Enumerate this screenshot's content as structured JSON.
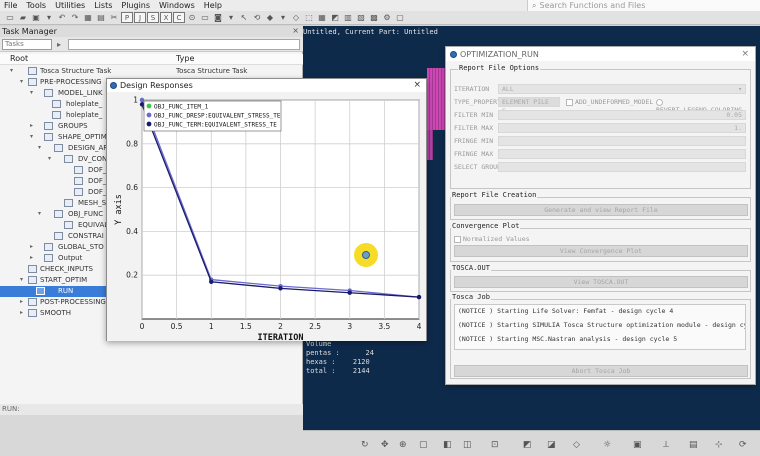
{
  "menu": [
    "File",
    "Tools",
    "Utilities",
    "Lists",
    "Plugins",
    "Windows",
    "Help"
  ],
  "search": {
    "placeholder": "Search Functions and Files"
  },
  "task_manager": {
    "title": "Task Manager",
    "close": "×",
    "filter_value": "Tasks",
    "columns": {
      "root": "Root",
      "type": "Type"
    },
    "rows": [
      {
        "label": "Tosca Structure Task",
        "type": "Tosca Structure Task"
      },
      {
        "label": "PRE-PROCESSING",
        "type": "PRE-PROCESSING"
      },
      {
        "label": "MODEL_LINK",
        "type": "MODEL_LINK"
      },
      {
        "label": "holeplate_",
        "type": ""
      },
      {
        "label": "holeplate_",
        "type": ""
      },
      {
        "label": "GROUPS",
        "type": ""
      },
      {
        "label": "SHAPE_OPTIM",
        "type": ""
      },
      {
        "label": "DESIGN_AR",
        "type": ""
      },
      {
        "label": "DV_CON",
        "type": ""
      },
      {
        "label": "DOF_",
        "type": ""
      },
      {
        "label": "DOF_",
        "type": ""
      },
      {
        "label": "DOF_",
        "type": ""
      },
      {
        "label": "MESH_S",
        "type": ""
      },
      {
        "label": "OBJ_FUNC",
        "type": ""
      },
      {
        "label": "EQUIVAL",
        "type": ""
      },
      {
        "label": "CONSTRAI",
        "type": ""
      },
      {
        "label": "GLOBAL_STO",
        "type": ""
      },
      {
        "label": "Output",
        "type": ""
      },
      {
        "label": "CHECK_INPUTS",
        "type": ""
      },
      {
        "label": "START_OPTIM",
        "type": ""
      },
      {
        "label": "RUN",
        "type": "RUN"
      },
      {
        "label": "POST-PROCESSING",
        "type": "POST-PROCESSING"
      },
      {
        "label": "SMOOTH",
        "type": "SMOOTH"
      }
    ],
    "status": "RUN:"
  },
  "graphics": {
    "title": "Untitled,  Current Part: Untitled",
    "info": [
      {
        "label": "Volume",
        "value": ""
      },
      {
        "label": "pentas :",
        "value": "24"
      },
      {
        "label": "hexas  :",
        "value": "2120"
      },
      {
        "label": "total  :",
        "value": "2144"
      }
    ]
  },
  "chart_window": {
    "title": "Design Responses",
    "close": "×"
  },
  "chart_data": {
    "type": "line",
    "title": "",
    "xlabel": "ITERATION",
    "ylabel": "Y axis",
    "xlim": [
      0,
      4
    ],
    "ylim": [
      0,
      1
    ],
    "xticks": [
      "0",
      "0.5",
      "1",
      "1.5",
      "2",
      "2.5",
      "3",
      "3.5",
      "4"
    ],
    "yticks": [
      "0.2",
      "0.4",
      "0.6",
      "0.8",
      "1"
    ],
    "grid": true,
    "legend_position": "top-left",
    "series": [
      {
        "name": "OBJ_FUNC_ITEM_1",
        "color": "#3cc84a",
        "x": [
          0
        ],
        "y": [
          1.0
        ]
      },
      {
        "name": "OBJ_FUNC_DRESP:EQUIVALENT_STRESS_TE",
        "color": "#6a6ad0",
        "x": [
          0,
          1,
          2,
          3,
          4
        ],
        "y": [
          1.0,
          0.18,
          0.15,
          0.13,
          0.1
        ]
      },
      {
        "name": "OBJ_FUNC_TERM:EQUIVALENT_STRESS_TE",
        "color": "#1a1a6a",
        "x": [
          0,
          1,
          2,
          3,
          4
        ],
        "y": [
          0.98,
          0.17,
          0.14,
          0.12,
          0.1
        ]
      }
    ]
  },
  "optimization": {
    "title": "OPTIMIZATION_RUN",
    "close": "×",
    "report_file_options": "Report File Options",
    "iteration_label": "ITERATION",
    "iteration_value": "ALL",
    "type_property_label": "TYPE_PROPERTY",
    "type_property_value": "ELEMENT PILE S",
    "add_undeformed": "ADD_UNDEFORMED_MODEL",
    "revert_legend": "REVERT_LEGEND_COLORING",
    "filter_min_label": "FILTER MIN",
    "filter_min_value": "0.05",
    "filter_max_label": "FILTER MAX",
    "filter_max_value": "1.",
    "fringe_min_label": "FRINGE MIN",
    "fringe_max_label": "FRINGE MAX",
    "select_group_label": "SELECT GROUP",
    "report_file_creation": "Report File Creation",
    "generate_btn": "Generate and view Report File",
    "convergence_plot": "Convergence Plot",
    "normalized_values": "Normalized Values",
    "view_convergence_btn": "View Convergence Plot",
    "tosca_out": "TOSCA.OUT",
    "view_tosca_btn": "View TOSCA.OUT",
    "tosca_job": "Tosca Job",
    "log": [
      "(NOTICE  ) Starting Life Solver: Femfat - design cycle 4",
      "(NOTICE  ) Starting SIMULIA Tosca Structure optimization module - design cycle",
      "(NOTICE  ) Starting MSC.Nastran analysis - design cycle 5"
    ],
    "abort_btn": "Abort Tosca Job"
  }
}
